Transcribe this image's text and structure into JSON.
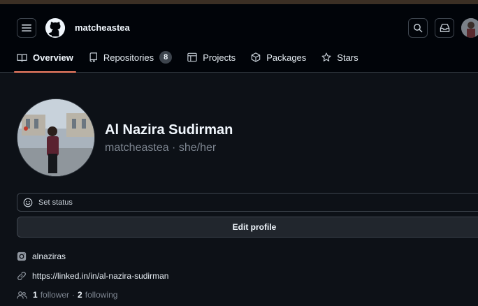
{
  "header": {
    "username": "matcheastea",
    "icons": [
      "menu-icon",
      "github-logo-icon",
      "search-icon",
      "inbox-icon"
    ]
  },
  "tabs": [
    {
      "label": "Overview",
      "icon": "book-icon",
      "active": true
    },
    {
      "label": "Repositories",
      "icon": "repo-icon",
      "count": "8"
    },
    {
      "label": "Projects",
      "icon": "table-icon"
    },
    {
      "label": "Packages",
      "icon": "package-icon"
    },
    {
      "label": "Stars",
      "icon": "star-icon"
    }
  ],
  "profile": {
    "full_name": "Al Nazira Sudirman",
    "handle_line": "matcheastea · she/her",
    "status_label": "Set status",
    "edit_label": "Edit profile",
    "instagram": "alnaziras",
    "link": "https://linked.in/in/al-nazira-sudirman",
    "followers_count": "1",
    "followers_label": "follower",
    "separator": "·",
    "following_count": "2",
    "following_label": "following"
  },
  "colors": {
    "background": "#0d1117",
    "header_bg": "#010409",
    "tab_underline": "#f78166",
    "border": "#3d444d",
    "muted_text": "#7d8590"
  }
}
